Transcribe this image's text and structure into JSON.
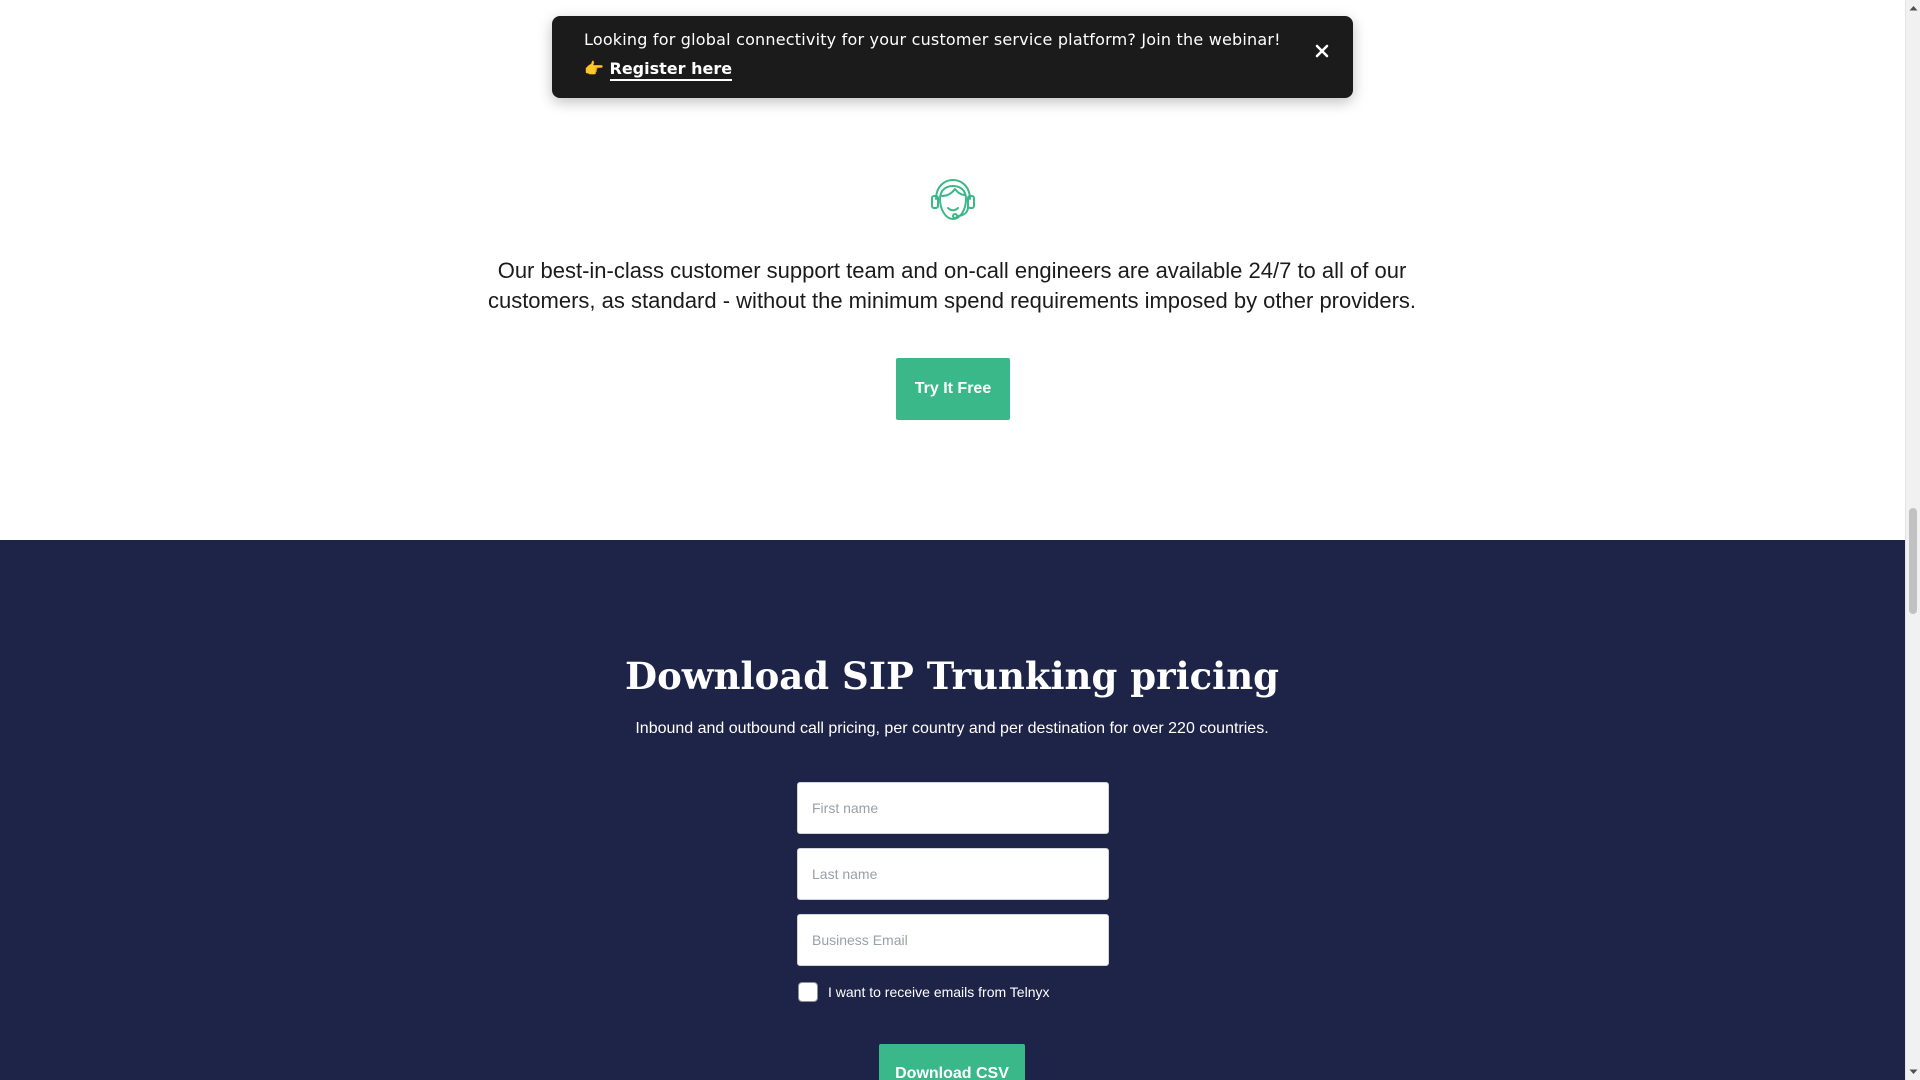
{
  "banner": {
    "message": "Looking for global connectivity for your customer service platform? Join the webinar!",
    "link_emoji": "👉",
    "link_label": "Register here",
    "close_icon": "close-icon"
  },
  "support": {
    "icon": "headset-agent-icon",
    "text": "Our best-in-class customer support team and on-call engineers are available 24/7 to all of our customers, as standard - without the minimum spend requirements imposed by other providers.",
    "cta_label": "Try It Free"
  },
  "pricing": {
    "title": "Download SIP Trunking pricing",
    "subtitle": "Inbound and outbound call pricing, per country and per destination for over 220 countries.",
    "form": {
      "first_name_placeholder": "First name",
      "first_name_value": "",
      "last_name_placeholder": "Last name",
      "last_name_value": "",
      "email_placeholder": "Business Email",
      "email_value": "",
      "consent_label": "I want to receive emails from Telnyx",
      "consent_checked": false,
      "submit_label": "Download CSV"
    }
  },
  "colors": {
    "accent": "#3bb88a",
    "pricing_background": "#1e2447",
    "banner_background": "#1b1b1b",
    "text_dark": "#1b1b1b"
  },
  "scrollbar": {
    "up_icon": "scroll-up-arrow-icon",
    "down_icon": "scroll-down-arrow-icon"
  }
}
